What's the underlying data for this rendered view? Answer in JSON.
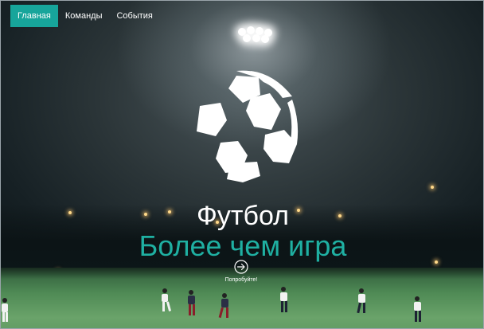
{
  "nav": {
    "items": [
      {
        "label": "Главная",
        "active": true
      },
      {
        "label": "Команды",
        "active": false
      },
      {
        "label": "События",
        "active": false
      }
    ]
  },
  "hero": {
    "title": "Футбол",
    "subtitle": "Более чем игра",
    "cta_label": "Попробуйте!",
    "cta_icon": "arrow-right-circle-icon",
    "logo_icon": "soccer-ball-icon"
  },
  "colors": {
    "accent": "#17a59b",
    "subtitle": "#1fb0a2",
    "text": "#ffffff"
  }
}
